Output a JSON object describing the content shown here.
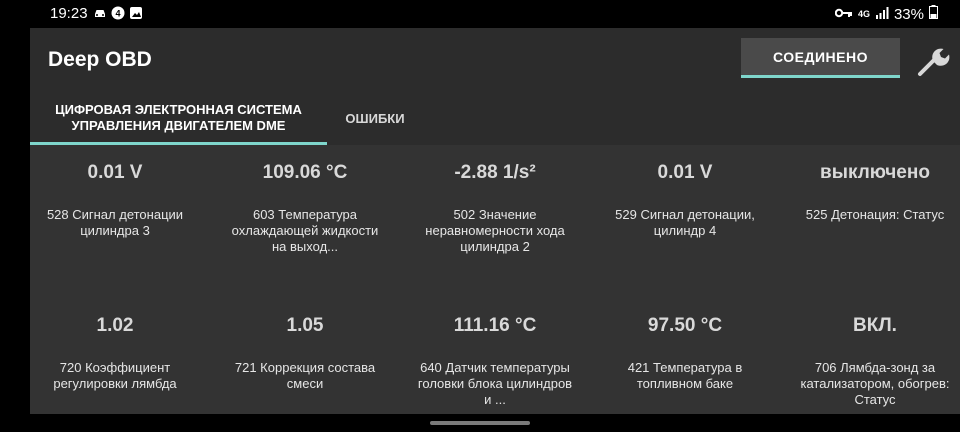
{
  "status_bar": {
    "time": "19:23",
    "left_icons": [
      "car-icon",
      "notification-icon",
      "image-icon"
    ],
    "network": "4G",
    "battery": "33%"
  },
  "app_bar": {
    "title": "Deep OBD",
    "connect_button": "СОЕДИНЕНО"
  },
  "tabs": [
    {
      "label": "ЦИФРОВАЯ ЭЛЕКТРОННАЯ СИСТЕМА УПРАВЛЕНИЯ ДВИГАТЕЛЕМ DME",
      "active": true
    },
    {
      "label": "ОШИБКИ",
      "active": false
    }
  ],
  "grid": [
    {
      "value": "0.01 V",
      "desc": "528 Сигнал детонации цилиндра 3"
    },
    {
      "value": "109.06 °C",
      "desc": "603 Температура охлаждающей жидкости на выход..."
    },
    {
      "value": "-2.88 1/s²",
      "desc": "502 Значение неравномерности хода цилиндра 2"
    },
    {
      "value": "0.01 V",
      "desc": "529 Сигнал детонации, цилиндр 4"
    },
    {
      "value": "выключено",
      "desc": "525 Детонация: Статус"
    },
    {
      "value": "1.02",
      "desc": "720 Коэффициент регулировки лямбда"
    },
    {
      "value": "1.05",
      "desc": "721 Коррекция состава смеси"
    },
    {
      "value": "111.16 °C",
      "desc": "640 Датчик температуры головки блока цилиндров и ..."
    },
    {
      "value": "97.50 °C",
      "desc": "421 Температура в топливном баке"
    },
    {
      "value": "ВКЛ.",
      "desc": "706 Лямбда-зонд за катализатором, обогрев: Статус"
    }
  ],
  "colors": {
    "accent": "#7fd6cc",
    "background": "#333333",
    "app_bar": "#2c2c2c"
  }
}
